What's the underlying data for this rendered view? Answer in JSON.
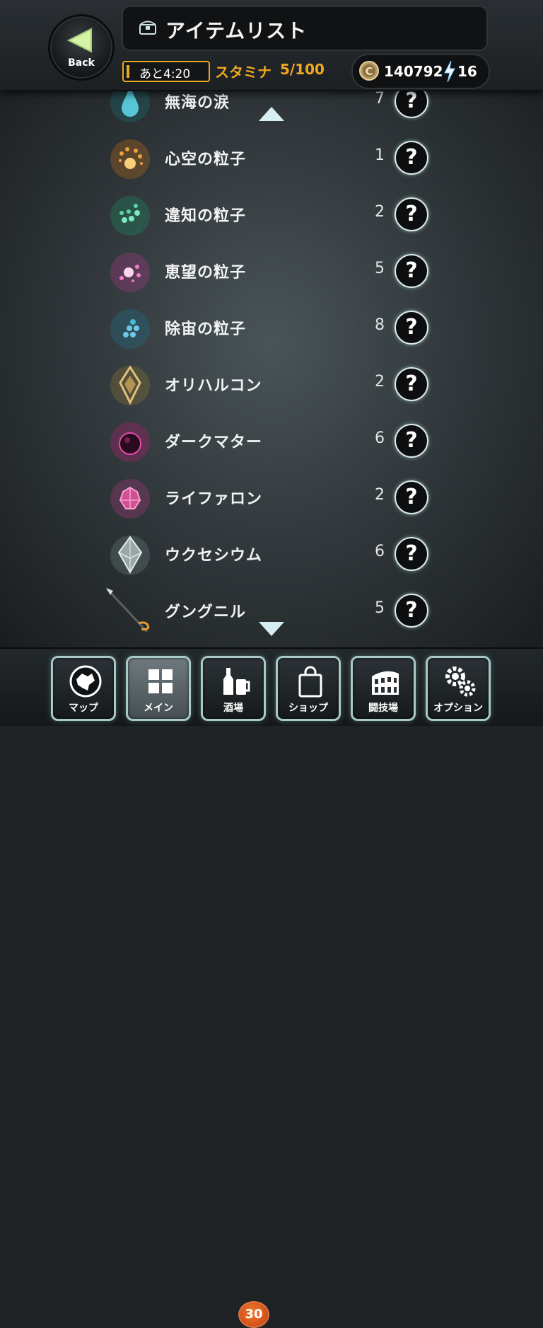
{
  "header": {
    "back_label": "Back",
    "title": "アイテムリスト",
    "timer_text": "あと4:20",
    "stamina_label": "スタミナ",
    "stamina_value": "5/100",
    "coins": "140792",
    "energy": "16"
  },
  "items": [
    {
      "name": "無海の涙",
      "qty": "7",
      "icon": "teardrop-icon",
      "color": "#56c6d6"
    },
    {
      "name": "心空の粒子",
      "qty": "1",
      "icon": "orange-particle-icon",
      "color": "#f0a040"
    },
    {
      "name": "違知の粒子",
      "qty": "2",
      "icon": "green-particle-icon",
      "color": "#56d9a6"
    },
    {
      "name": "恵望の粒子",
      "qty": "5",
      "icon": "pink-particle-icon",
      "color": "#f07fc4"
    },
    {
      "name": "除宙の粒子",
      "qty": "8",
      "icon": "blue-particle-icon",
      "color": "#4ab8d8"
    },
    {
      "name": "オリハルコン",
      "qty": "2",
      "icon": "orichalcum-crystal-icon",
      "color": "#e1c27a"
    },
    {
      "name": "ダークマター",
      "qty": "6",
      "icon": "dark-matter-orb-icon",
      "color": "#e04ca8"
    },
    {
      "name": "ライファロン",
      "qty": "2",
      "icon": "pink-gem-cluster-icon",
      "color": "#f06fb2"
    },
    {
      "name": "ウクセシウム",
      "qty": "6",
      "icon": "silver-crystal-icon",
      "color": "#c8d3d4"
    },
    {
      "name": "グングニル",
      "qty": "5",
      "icon": "spear-icon",
      "color": "#e6a030"
    }
  ],
  "help_glyph": "?",
  "nav": [
    {
      "label": "マップ",
      "icon": "globe-map-icon"
    },
    {
      "label": "メイン",
      "icon": "grid-main-icon",
      "active": true
    },
    {
      "label": "酒場",
      "icon": "tavern-bottles-icon"
    },
    {
      "label": "ショップ",
      "icon": "shopping-bag-icon"
    },
    {
      "label": "闘技場",
      "icon": "colosseum-icon"
    },
    {
      "label": "オプション",
      "icon": "gears-icon"
    }
  ],
  "tavern_badge": "30",
  "colors": {
    "accent": "#f0a81f",
    "help_glow": "#b4fff0",
    "nav_border": "#a9c9c7"
  }
}
